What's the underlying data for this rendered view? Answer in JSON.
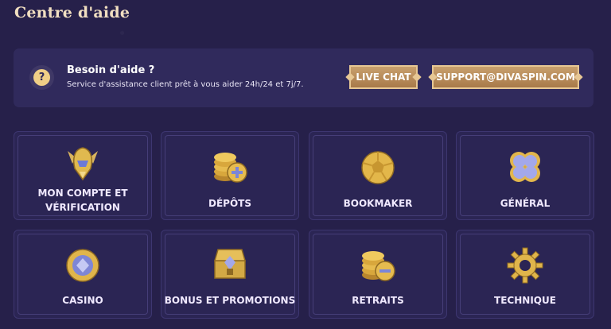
{
  "page": {
    "title": "Centre d'aide"
  },
  "help": {
    "icon_symbol": "?",
    "heading": "Besoin d'aide ?",
    "subtitle": "Service d'assistance client prêt à vous aider 24h/24 et 7j/7.",
    "live_chat": "LIVE CHAT",
    "support_email": "SUPPORT@DIVASPIN.COM"
  },
  "categories": [
    {
      "label": "MON COMPTE ET VÉRIFICATION",
      "icon": "helmet-icon"
    },
    {
      "label": "DÉPÔTS",
      "icon": "coins-plus-icon"
    },
    {
      "label": "BOOKMAKER",
      "icon": "ball-icon"
    },
    {
      "label": "GÉNÉRAL",
      "icon": "clover-icon"
    },
    {
      "label": "CASINO",
      "icon": "casino-chip-icon"
    },
    {
      "label": "BONUS ET PROMOTIONS",
      "icon": "treasure-chest-icon"
    },
    {
      "label": "RETRAITS",
      "icon": "coins-minus-icon"
    },
    {
      "label": "TECHNIQUE",
      "icon": "gear-icon"
    }
  ],
  "colors": {
    "background": "#26204a",
    "gold": "#e7c794",
    "panel": "#302a5c"
  }
}
